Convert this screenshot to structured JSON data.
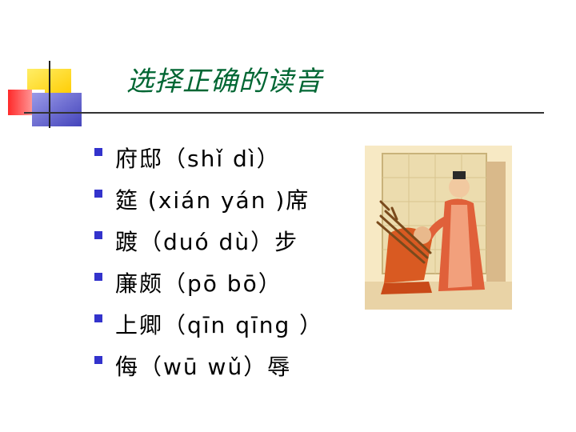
{
  "slide": {
    "title": "选择正确的读音",
    "items": [
      {
        "text": "府邸（shǐ   dì）"
      },
      {
        "text": "筵 (xián   yán )席"
      },
      {
        "text": "踱（duó   dù）步"
      },
      {
        "text": "廉颇（pō   bō）"
      },
      {
        "text": "上卿（qīn  qīng ）"
      },
      {
        "text": "侮（wū   wǔ）辱"
      }
    ]
  },
  "colors": {
    "title": "#006633",
    "bullet": "#3333cc",
    "deco_yellow": "#ffcc00",
    "deco_red": "#ff3333",
    "deco_blue": "#5a5acc"
  },
  "illustration": {
    "icon": "historical-figures-illustration"
  }
}
